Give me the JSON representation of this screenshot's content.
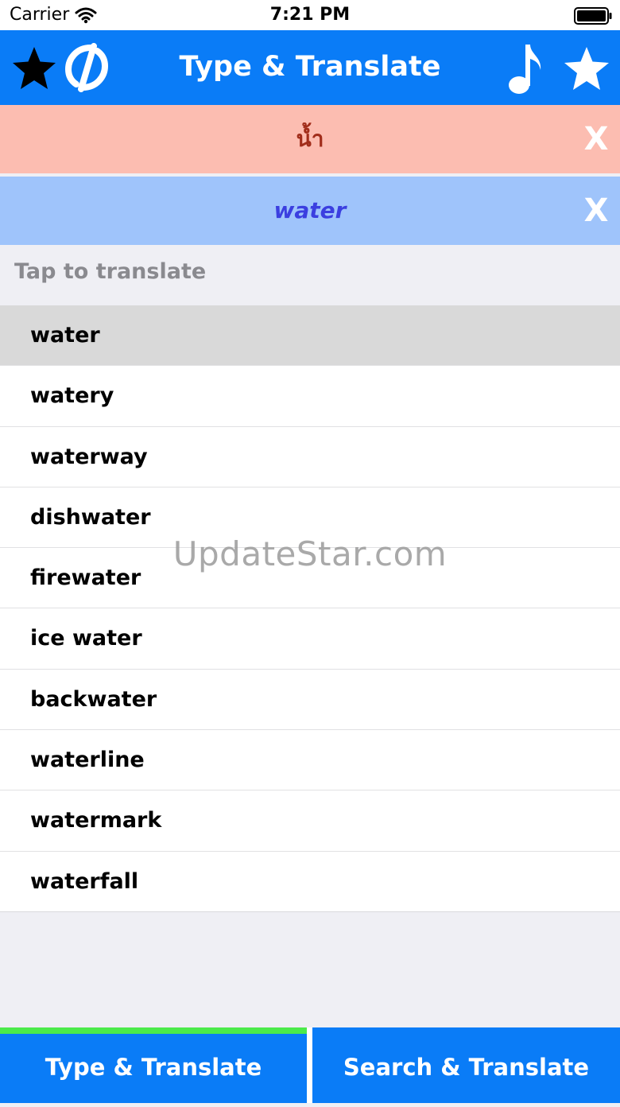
{
  "status_bar": {
    "carrier": "Carrier",
    "time": "7:21 PM"
  },
  "nav": {
    "title": "Type & Translate"
  },
  "source_input": {
    "value": "น้ำ",
    "clear_label": "X"
  },
  "target_input": {
    "value": "water",
    "clear_label": "X"
  },
  "list": {
    "header": "Tap to translate",
    "items": [
      "water",
      "watery",
      "waterway",
      "dishwater",
      "firewater",
      "ice water",
      "backwater",
      "waterline",
      "watermark",
      "waterfall"
    ]
  },
  "watermark": "UpdateStar.com",
  "tabs": [
    {
      "label": "Type & Translate",
      "selected": true
    },
    {
      "label": "Search & Translate",
      "selected": false
    }
  ],
  "colors": {
    "nav_blue": "#0a7cf7",
    "source_bg": "#fcbdb1",
    "target_bg": "#9fc4fb",
    "active_tab_indicator": "#4bea4b"
  }
}
